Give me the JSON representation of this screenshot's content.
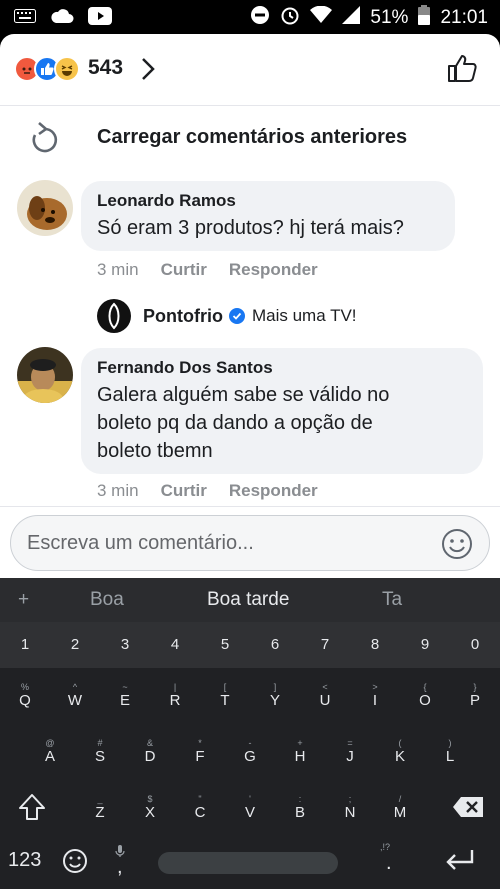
{
  "status_bar": {
    "battery": "51%",
    "time": "21:01"
  },
  "reactions": {
    "count": "543",
    "icons": [
      "angry-reaction",
      "like-reaction",
      "haha-reaction"
    ]
  },
  "load_more": {
    "label": "Carregar comentários anteriores"
  },
  "comments": [
    {
      "author": "Leonardo Ramos",
      "text": "Só eram 3 produtos? hj terá mais?",
      "time": "3 min",
      "like": "Curtir",
      "reply": "Responder"
    },
    {
      "author": "Fernando Dos Santos",
      "text_lines": [
        "Galera alguém sabe se válido no",
        "boleto pq da dando a opção de",
        "boleto tbemn"
      ],
      "time": "3 min",
      "like": "Curtir",
      "reply": "Responder"
    }
  ],
  "reply_preview": {
    "author": "Pontofrio",
    "text": "Mais uma TV!"
  },
  "composer": {
    "placeholder": "Escreva um comentário..."
  },
  "keyboard": {
    "suggestions": [
      "+",
      "Boa",
      "Boa tarde",
      "Ta"
    ],
    "numbers": [
      "1",
      "2",
      "3",
      "4",
      "5",
      "6",
      "7",
      "8",
      "9",
      "0"
    ],
    "row1": [
      {
        "k": "Q",
        "s": "%"
      },
      {
        "k": "W",
        "s": "^"
      },
      {
        "k": "E",
        "s": "~"
      },
      {
        "k": "R",
        "s": "|"
      },
      {
        "k": "T",
        "s": "["
      },
      {
        "k": "Y",
        "s": "]"
      },
      {
        "k": "U",
        "s": "<"
      },
      {
        "k": "I",
        "s": ">"
      },
      {
        "k": "O",
        "s": "{"
      },
      {
        "k": "P",
        "s": "}"
      }
    ],
    "row2": [
      {
        "k": "A",
        "s": "@"
      },
      {
        "k": "S",
        "s": "#"
      },
      {
        "k": "D",
        "s": "&"
      },
      {
        "k": "F",
        "s": "*"
      },
      {
        "k": "G",
        "s": "-"
      },
      {
        "k": "H",
        "s": "+"
      },
      {
        "k": "J",
        "s": "="
      },
      {
        "k": "K",
        "s": "("
      },
      {
        "k": "L",
        "s": ")"
      }
    ],
    "row3": [
      {
        "k": "Z",
        "s": "_"
      },
      {
        "k": "X",
        "s": "$"
      },
      {
        "k": "C",
        "s": "\""
      },
      {
        "k": "V",
        "s": "'"
      },
      {
        "k": "B",
        "s": ":"
      },
      {
        "k": "N",
        "s": ";"
      },
      {
        "k": "M",
        "s": "/"
      }
    ],
    "mode_key": "123",
    "comma": ",",
    "period": ".",
    "period_sub": ",!?"
  }
}
